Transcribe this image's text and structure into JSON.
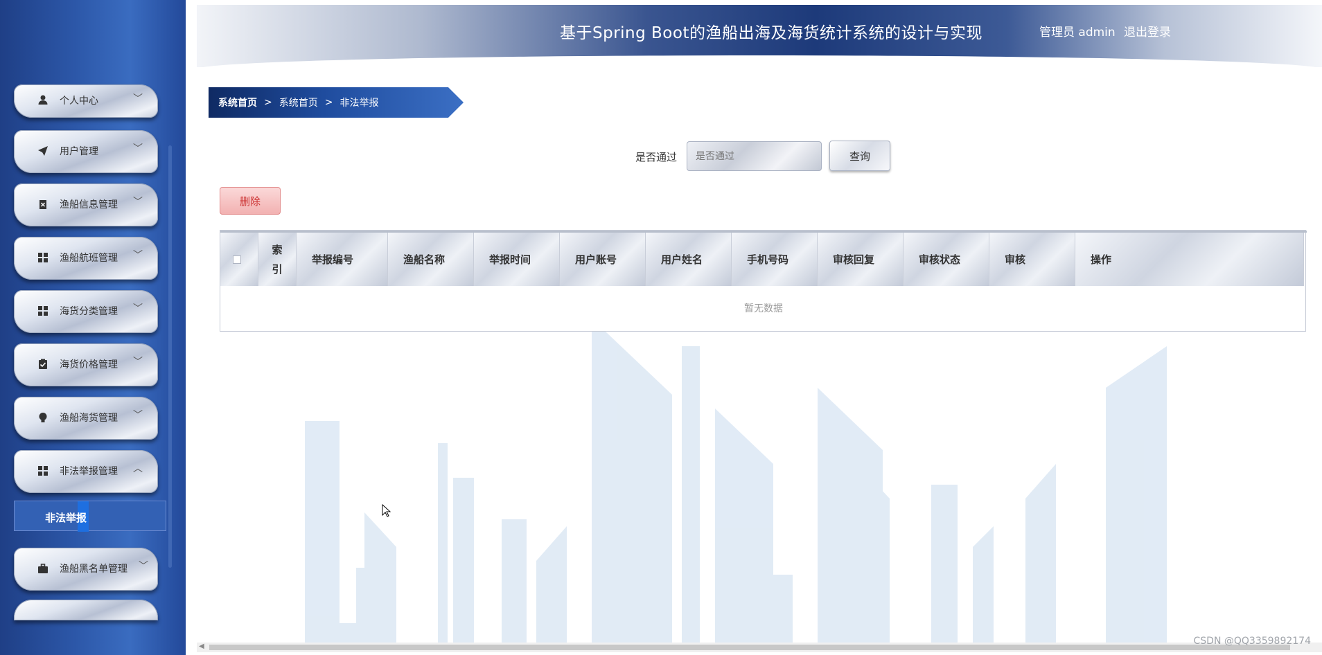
{
  "header": {
    "title": "基于Spring Boot的渔船出海及海货统计系统的设计与实现",
    "admin": "管理员 admin",
    "logout": "退出登录"
  },
  "sidebar": {
    "items": [
      {
        "label": "个人中心",
        "icon": "user-icon",
        "chevron": "﹀"
      },
      {
        "label": "用户管理",
        "icon": "paper-plane-icon",
        "chevron": "﹀"
      },
      {
        "label": "渔船信息管理",
        "icon": "delete-box-icon",
        "chevron": "﹀"
      },
      {
        "label": "渔船航班管理",
        "icon": "grid-icon",
        "chevron": "﹀"
      },
      {
        "label": "海货分类管理",
        "icon": "grid-icon",
        "chevron": "﹀"
      },
      {
        "label": "海货价格管理",
        "icon": "clipboard-check-icon",
        "chevron": "﹀"
      },
      {
        "label": "渔船海货管理",
        "icon": "bulb-icon",
        "chevron": "﹀"
      },
      {
        "label": "非法举报管理",
        "icon": "grid-icon",
        "chevron": "︿"
      },
      {
        "label": "渔船黑名单管理",
        "icon": "briefcase-icon",
        "chevron": "﹀"
      }
    ],
    "submenu_active": "非法举报"
  },
  "breadcrumb": {
    "home": "系统首页",
    "sep": ">",
    "level1": "系统首页",
    "level2": "非法举报"
  },
  "search": {
    "label": "是否通过",
    "placeholder": "是否通过",
    "button": "查询"
  },
  "toolbar": {
    "delete_label": "删除"
  },
  "table": {
    "index_header": "索引",
    "columns": [
      "举报编号",
      "渔船名称",
      "举报时间",
      "用户账号",
      "用户姓名",
      "手机号码",
      "审核回复",
      "审核状态",
      "审核",
      "操作"
    ],
    "empty_text": "暂无数据"
  },
  "watermark": "CSDN @QQ3359892174",
  "colors": {
    "sidebar_bg": "#2c57a8",
    "header_dark": "#1d3a7a",
    "delete_text": "#cc3333"
  }
}
